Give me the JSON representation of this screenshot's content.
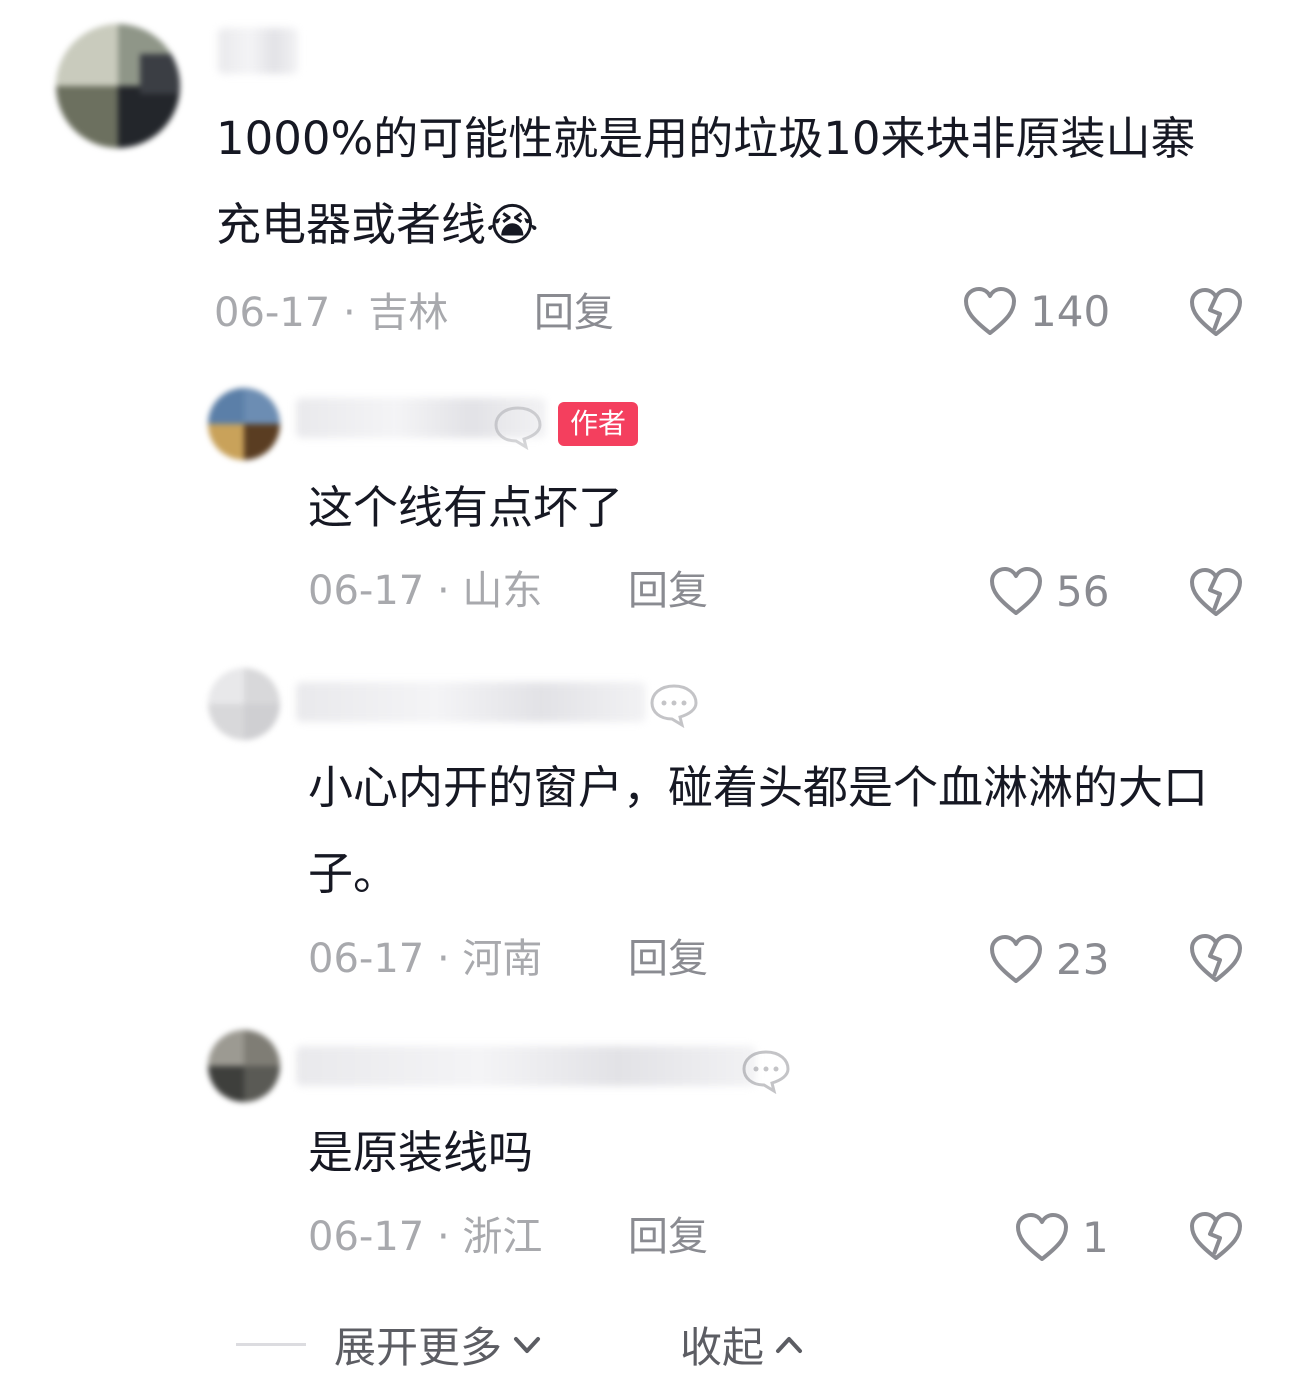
{
  "comments": [
    {
      "text": "1000%的可能性就是用的垃圾10来块非原装山寨充电器或者线",
      "emoji": "😭",
      "date": "06-17",
      "location": "吉林",
      "reply_label": "回复",
      "likes": "140"
    },
    {
      "badge": "作者",
      "text": "这个线有点坏了",
      "date": "06-17",
      "location": "山东",
      "reply_label": "回复",
      "likes": "56"
    },
    {
      "text": "小心内开的窗户，碰着头都是个血淋淋的大口子。",
      "date": "06-17",
      "location": "河南",
      "reply_label": "回复",
      "likes": "23"
    },
    {
      "text": "是原装线吗",
      "date": "06-17",
      "location": "浙江",
      "reply_label": "回复",
      "likes": "1"
    }
  ],
  "footer": {
    "expand_label": "展开更多",
    "collapse_label": "收起"
  },
  "separator": "·",
  "colors": {
    "author_badge": "#f43f5e",
    "meta_text": "#a8a9ad",
    "body_text": "#161823"
  },
  "icons": [
    "heart-icon",
    "broken-heart-icon",
    "chat-bubble-icon",
    "chevron-down-icon",
    "chevron-up-icon"
  ]
}
